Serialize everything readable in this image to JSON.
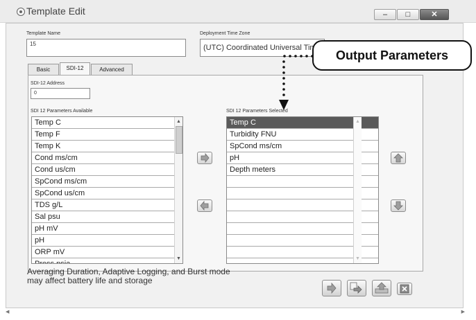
{
  "window": {
    "title": "Template Edit"
  },
  "template_name": {
    "label": "Template Name",
    "value": "15"
  },
  "timezone": {
    "label": "Deployment Time Zone",
    "value": "(UTC) Coordinated Universal Time"
  },
  "callout": {
    "text": "Output Parameters"
  },
  "tabs": [
    {
      "label": "Basic"
    },
    {
      "label": "SDI-12"
    },
    {
      "label": "Advanced"
    }
  ],
  "active_tab": "SDI-12",
  "sdi_address": {
    "label": "SDI-12 Address",
    "value": "0"
  },
  "available": {
    "label": "SDI 12 Parameters Available",
    "items": [
      "Temp C",
      "Temp F",
      "Temp K",
      "Cond ms/cm",
      "Cond us/cm",
      "SpCond ms/cm",
      "SpCond us/cm",
      "TDS g/L",
      "Sal psu",
      "pH mV",
      "pH",
      "ORP mV",
      "Press psia"
    ]
  },
  "selected": {
    "label": "SDI 12 Parameters Selected",
    "items": [
      "Temp C",
      "Turbidity FNU",
      "SpCond ms/cm",
      "pH",
      "Depth meters"
    ],
    "highlighted": "Temp C"
  },
  "note": {
    "line1": "Averaging Duration, Adaptive Logging, and Burst mode",
    "line2": "may affect battery life and storage"
  },
  "icons": {
    "add": "arrow-right-icon",
    "remove": "arrow-left-icon",
    "move_up": "arrow-up-icon",
    "move_down": "arrow-down-icon",
    "close": "close-icon"
  }
}
